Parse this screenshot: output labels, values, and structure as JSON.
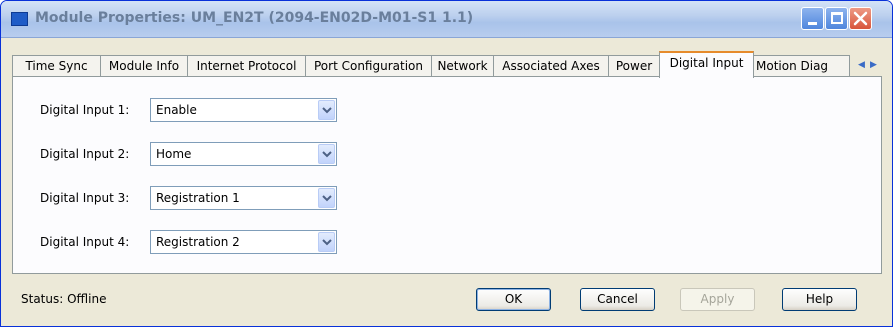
{
  "window": {
    "title": "Module Properties: UM_EN2T (2094-EN02D-M01-S1 1.1)"
  },
  "tabs": [
    {
      "label": "Time Sync"
    },
    {
      "label": "Module Info"
    },
    {
      "label": "Internet Protocol"
    },
    {
      "label": "Port Configuration"
    },
    {
      "label": "Network"
    },
    {
      "label": "Associated Axes"
    },
    {
      "label": "Power"
    },
    {
      "label": "Digital Input",
      "active": true
    },
    {
      "label": "Motion Diag"
    }
  ],
  "tab_scroll": {
    "left": "◀",
    "right": "▶"
  },
  "digital_inputs": [
    {
      "label": "Digital Input 1:",
      "value": "Enable"
    },
    {
      "label": "Digital Input 2:",
      "value": "Home"
    },
    {
      "label": "Digital Input 3:",
      "value": "Registration 1"
    },
    {
      "label": "Digital Input 4:",
      "value": "Registration 2"
    }
  ],
  "status": {
    "text": "Status:  Offline"
  },
  "buttons": {
    "ok": "OK",
    "cancel": "Cancel",
    "apply": "Apply",
    "help": "Help"
  },
  "colors": {
    "title_bar": "#bcd0ee",
    "active_tab_accent": "#e68b2c",
    "dialog_bg": "#ece9d8",
    "panel_bg": "#fcfcfe"
  }
}
